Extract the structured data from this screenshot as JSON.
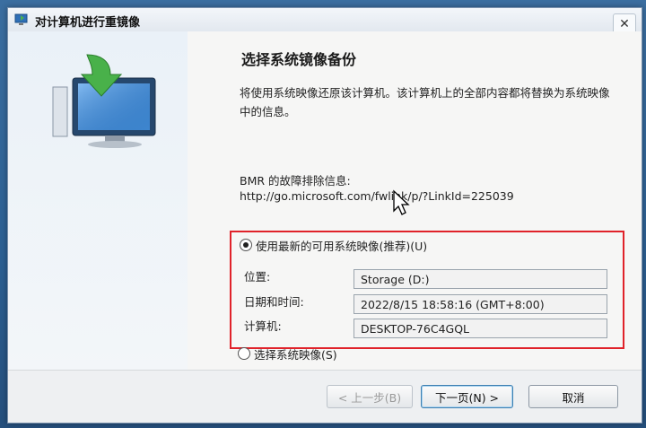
{
  "window": {
    "title": "对计算机进行重镜像",
    "close_glyph": "✕",
    "icon": "reimage-computer-icon"
  },
  "page": {
    "heading": "选择系统镜像备份",
    "description": "将使用系统映像还原该计算机。该计算机上的全部内容都将替换为系统映像中的信息。",
    "bmr_label": "BMR 的故障排除信息:",
    "bmr_link": "http://go.microsoft.com/fwlink/p/?LinkId=225039"
  },
  "options": {
    "latest": {
      "label": "使用最新的可用系统映像(推荐)(U)",
      "selected": true
    },
    "choose": {
      "label": "选择系统映像(S)",
      "selected": false
    }
  },
  "details": {
    "location_label": "位置:",
    "location_value": "Storage (D:)",
    "datetime_label": "日期和时间:",
    "datetime_value": "2022/8/15 18:58:16 (GMT+8:00)",
    "computer_label": "计算机:",
    "computer_value": "DESKTOP-76C4GQL"
  },
  "buttons": {
    "back": "< 上一步(B)",
    "next": "下一页(N) >",
    "cancel": "取消"
  },
  "colors": {
    "highlight_border": "#e0222a",
    "desktop": "#2c5f92"
  }
}
